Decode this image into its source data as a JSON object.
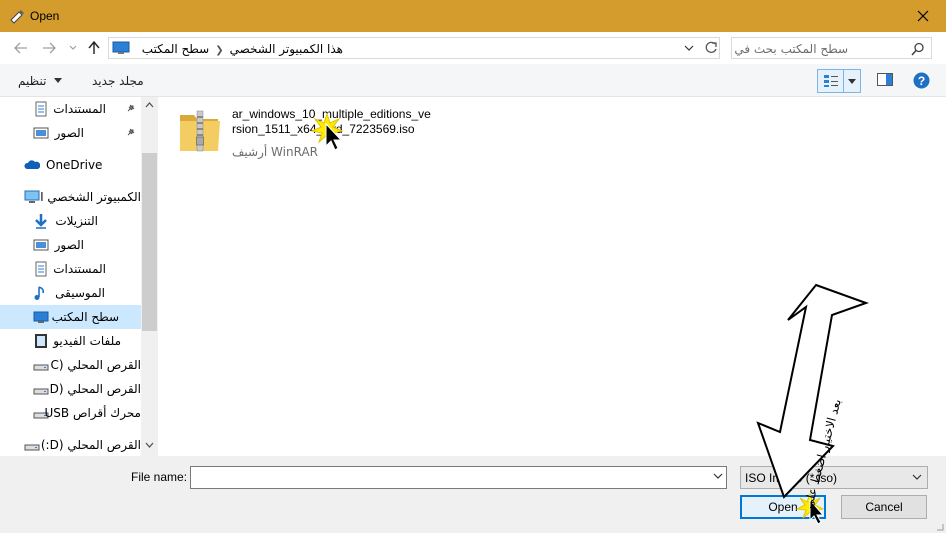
{
  "window": {
    "title": "Open",
    "accent": "#d39c2d"
  },
  "address": {
    "crumbs": [
      "هذا الكمبيوتر الشخصي",
      "سطح المكتب"
    ]
  },
  "search": {
    "placeholder": "سطح المكتب بحث في"
  },
  "toolbar": {
    "organize_label": "تنظيم",
    "new_folder_label": "مجلد جديد"
  },
  "nav": {
    "items": [
      {
        "label": "المستندات",
        "icon": "documents-icon",
        "pinned": true
      },
      {
        "label": "الصور",
        "icon": "pictures-icon",
        "pinned": true
      },
      {
        "label": "OneDrive",
        "icon": "onedrive-icon"
      },
      {
        "label": "الكمبيوتر الشخصي ا",
        "icon": "computer-icon"
      },
      {
        "label": "التنزيلات",
        "icon": "downloads-icon"
      },
      {
        "label": "الصور",
        "icon": "pictures-icon"
      },
      {
        "label": "المستندات",
        "icon": "documents-icon"
      },
      {
        "label": "الموسيقى",
        "icon": "music-icon"
      },
      {
        "label": "سطح المكتب",
        "icon": "desktop-icon",
        "selected": true
      },
      {
        "label": "ملفات الفيديو",
        "icon": "video-icon"
      },
      {
        "label": "القرص المحلي (C",
        "icon": "drive-icon"
      },
      {
        "label": "القرص المحلي (D",
        "icon": "drive-icon"
      },
      {
        "label": "محرك أقراص USB",
        "icon": "drive-icon"
      },
      {
        "label": "القرص المحلي (D:)",
        "icon": "drive-icon"
      }
    ]
  },
  "files": [
    {
      "name": "ar_windows_10_multiple_editions_version_1511_x64_dvd_7223569.iso",
      "type": "أرشيف WinRAR",
      "icon": "winrar-archive-icon"
    }
  ],
  "bottom": {
    "filename_label": "File name:",
    "filename_value": "",
    "filter_value": "ISO Image (*.iso)",
    "open_label": "Open",
    "cancel_label": "Cancel"
  },
  "annotation": {
    "text": "بعد الاختيار اضغط على"
  }
}
